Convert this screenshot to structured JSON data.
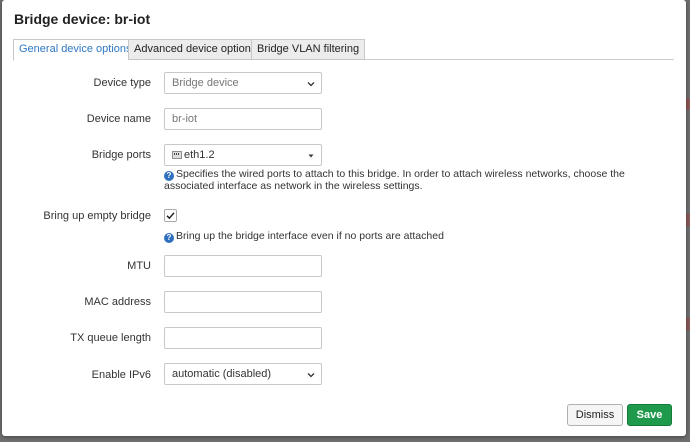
{
  "dialog": {
    "title": "Bridge device: br-iot",
    "tabs": [
      "General device options",
      "Advanced device options",
      "Bridge VLAN filtering"
    ],
    "active_tab": "General device options"
  },
  "form": {
    "device_type": {
      "label": "Device type",
      "value": "Bridge device"
    },
    "device_name": {
      "label": "Device name",
      "value": "br-iot"
    },
    "bridge_ports": {
      "label": "Bridge ports",
      "value": "eth1.2",
      "help": "Specifies the wired ports to attach to this bridge. In order to attach wireless networks, choose the associated interface as network in the wireless settings."
    },
    "bring_up_empty": {
      "label": "Bring up empty bridge",
      "checked": true,
      "help": "Bring up the bridge interface even if no ports are attached"
    },
    "mtu": {
      "label": "MTU",
      "value": ""
    },
    "mac_address": {
      "label": "MAC address",
      "value": ""
    },
    "tx_queue_length": {
      "label": "TX queue length",
      "value": ""
    },
    "enable_ipv6": {
      "label": "Enable IPv6",
      "value": "automatic (disabled)"
    }
  },
  "actions": {
    "dismiss": "Dismiss",
    "save": "Save"
  },
  "colors": {
    "accent": "#2f78c4",
    "save": "#1f9a4d",
    "info": "#2f6fbf"
  }
}
